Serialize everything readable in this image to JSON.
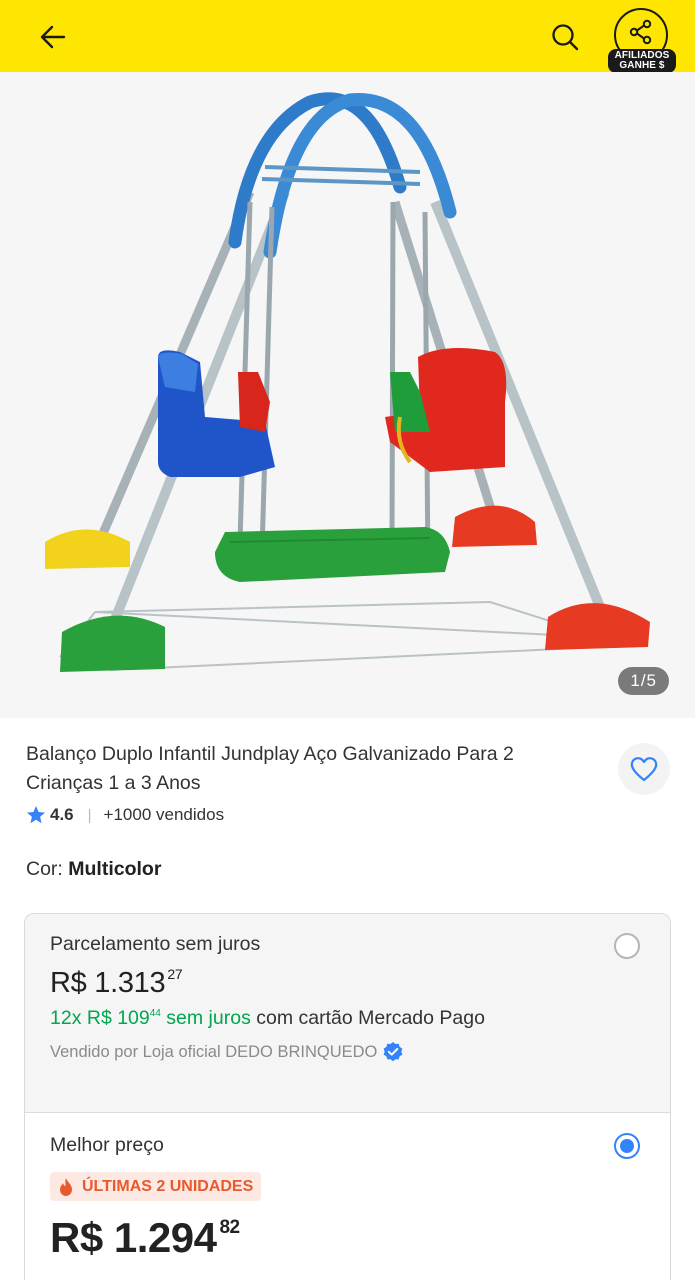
{
  "header": {
    "back_icon": "arrow-left-icon",
    "search_icon": "search-icon",
    "affiliate_icon": "share-icon",
    "affiliate_label_1": "AFILIADOS",
    "affiliate_label_2": "GANHE $",
    "background_color": "#ffe600"
  },
  "gallery": {
    "counter": "1/5"
  },
  "product": {
    "title": "Balanço Duplo Infantil Jundplay Aço Galvanizado Para 2 Crianças 1 a 3 Anos",
    "rating": "4.6",
    "sold": "+1000 vendidos",
    "color_label": "Cor: ",
    "color_value": "Multicolor",
    "favorite_icon": "heart-icon"
  },
  "offers": [
    {
      "title": "Parcelamento sem juros",
      "currency": "R$",
      "price_integer": "1.313",
      "price_cents": "27",
      "installments_count": "12x R$ 109",
      "installments_cents": "44",
      "installments_suffix": " sem juros",
      "installments_card": " com cartão Mercado Pago",
      "seller": "Vendido por Loja oficial DEDO BRINQUEDO",
      "selected": false
    },
    {
      "title": "Melhor preço",
      "badge": "ÚLTIMAS 2 UNIDADES",
      "currency": "R$",
      "price_integer": "1.294",
      "price_cents": "82",
      "selected": true
    }
  ],
  "colors": {
    "accent_blue": "#3483fa",
    "green": "#00a650",
    "badge_orange": "#e85a2c"
  }
}
